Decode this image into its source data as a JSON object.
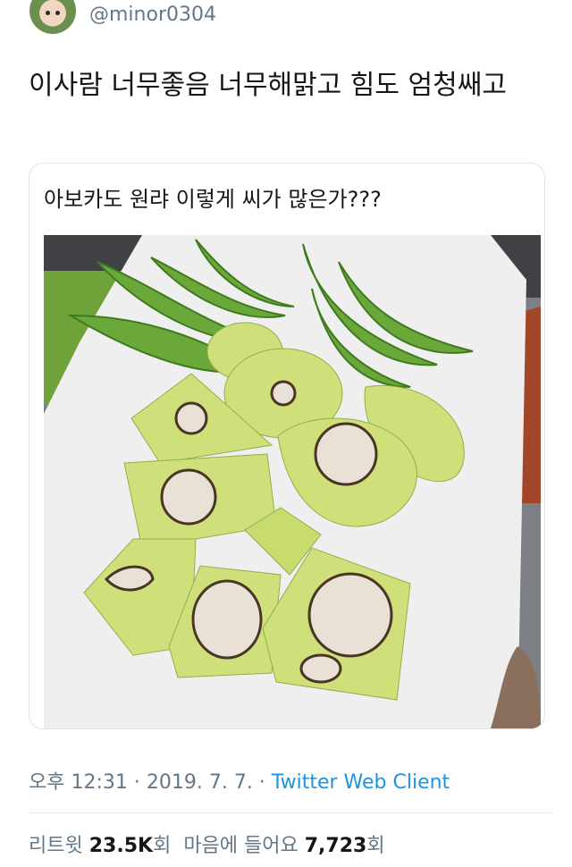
{
  "tweet": {
    "handle": "@minor0304",
    "text": "이사람 너무좋음 너무해맑고 힘도 엄청쌔고",
    "quoted": {
      "text": "아보카도 원랴 이렇게 씨가 많은가???",
      "image": "avocado-photo"
    },
    "time": "오후 12:31",
    "sep1": " · ",
    "date": "2019. 7. 7.",
    "sep2": " · ",
    "client": "Twitter Web Client",
    "retweets_label": "리트윗",
    "retweets_value": "23.5K",
    "retweets_unit": "회",
    "likes_label": "마음에 들어요",
    "likes_value": "7,723",
    "likes_unit": "회"
  },
  "colors": {
    "text": "#14171a",
    "secondary": "#657786",
    "link": "#1b95e0",
    "border": "#dfe3e6",
    "avocado_flesh": "#cfe07a",
    "avocado_skin": "#5f9a2f",
    "seed": "#e9e0d6"
  }
}
